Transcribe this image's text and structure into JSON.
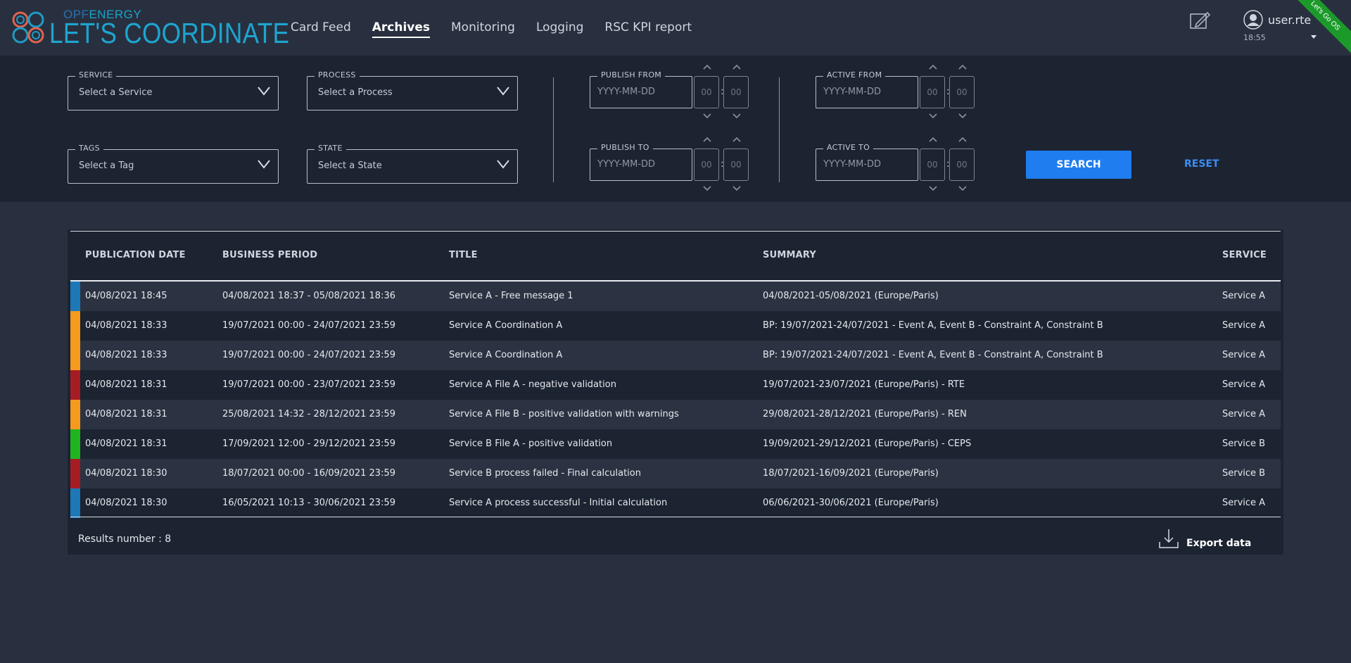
{
  "header": {
    "brand_small_1": "OPF",
    "brand_small_2": "ENERGY",
    "brand_title": "LET'S COORDINATE",
    "nav": [
      "Card Feed",
      "Archives",
      "Monitoring",
      "Logging",
      "RSC KPI report"
    ],
    "active_nav": "Archives",
    "user": "user.rte",
    "time": "18:55",
    "ribbon": "Let's Go OS"
  },
  "filters": {
    "service": {
      "legend": "SERVICE",
      "value": "Select a Service"
    },
    "process": {
      "legend": "PROCESS",
      "value": "Select a Process"
    },
    "tags": {
      "legend": "TAGS",
      "value": "Select a Tag"
    },
    "state": {
      "legend": "STATE",
      "value": "Select a State"
    },
    "publish_from": {
      "legend": "PUBLISH FROM",
      "placeholder": "YYYY-MM-DD",
      "hour": "00",
      "minute": "00"
    },
    "publish_to": {
      "legend": "PUBLISH TO",
      "placeholder": "YYYY-MM-DD",
      "hour": "00",
      "minute": "00"
    },
    "active_from": {
      "legend": "ACTIVE FROM",
      "placeholder": "YYYY-MM-DD",
      "hour": "00",
      "minute": "00"
    },
    "active_to": {
      "legend": "ACTIVE TO",
      "placeholder": "YYYY-MM-DD",
      "hour": "00",
      "minute": "00"
    },
    "time_separator": ":",
    "search_label": "SEARCH",
    "reset_label": "RESET"
  },
  "table": {
    "columns": [
      "PUBLICATION DATE",
      "BUSINESS PERIOD",
      "TITLE",
      "SUMMARY",
      "SERVICE"
    ],
    "rows": [
      {
        "severity_color": "#1d78b8",
        "pub": "04/08/2021 18:45",
        "period": "04/08/2021 18:37 - 05/08/2021 18:36",
        "title": "Service A - Free message 1",
        "summary": "04/08/2021-05/08/2021 (Europe/Paris)",
        "service": "Service A"
      },
      {
        "severity_color": "#f59a1c",
        "pub": "04/08/2021 18:33",
        "period": "19/07/2021 00:00 - 24/07/2021 23:59",
        "title": "Service A Coordination A",
        "summary": "BP: 19/07/2021-24/07/2021 - Event A, Event B - Constraint A, Constraint B",
        "service": "Service A"
      },
      {
        "severity_color": "#f59a1c",
        "pub": "04/08/2021 18:33",
        "period": "19/07/2021 00:00 - 24/07/2021 23:59",
        "title": "Service A Coordination A",
        "summary": "BP: 19/07/2021-24/07/2021 - Event A, Event B - Constraint A, Constraint B",
        "service": "Service A"
      },
      {
        "severity_color": "#a61c24",
        "pub": "04/08/2021 18:31",
        "period": "19/07/2021 00:00 - 23/07/2021 23:59",
        "title": "Service A File A - negative validation",
        "summary": "19/07/2021-23/07/2021 (Europe/Paris) - RTE",
        "service": "Service A"
      },
      {
        "severity_color": "#f59a1c",
        "pub": "04/08/2021 18:31",
        "period": "25/08/2021 14:32 - 28/12/2021 23:59",
        "title": "Service A File B - positive validation with warnings",
        "summary": "29/08/2021-28/12/2021 (Europe/Paris) - REN",
        "service": "Service A"
      },
      {
        "severity_color": "#1fb51f",
        "pub": "04/08/2021 18:31",
        "period": "17/09/2021 12:00 - 29/12/2021 23:59",
        "title": "Service B File A - positive validation",
        "summary": "19/09/2021-29/12/2021 (Europe/Paris) - CEPS",
        "service": "Service B"
      },
      {
        "severity_color": "#a61c24",
        "pub": "04/08/2021 18:30",
        "period": "18/07/2021 00:00 - 16/09/2021 23:59",
        "title": "Service B process failed - Final calculation",
        "summary": "18/07/2021-16/09/2021 (Europe/Paris)",
        "service": "Service B"
      },
      {
        "severity_color": "#1d78b8",
        "pub": "04/08/2021 18:30",
        "period": "16/05/2021 10:13 - 30/06/2021 23:59",
        "title": "Service A process successful - Initial calculation",
        "summary": "06/06/2021-30/06/2021 (Europe/Paris)",
        "service": "Service A"
      }
    ],
    "results_text": "Results number : 8",
    "export_label": "Export data"
  },
  "icons": {
    "logo": "rings-logo-icon",
    "edit": "edit-note-icon",
    "user": "user-avatar-icon",
    "dropdown": "chevron-down-icon",
    "spinner_up": "chevron-up-icon",
    "spinner_down": "chevron-down-icon",
    "export": "download-icon"
  }
}
